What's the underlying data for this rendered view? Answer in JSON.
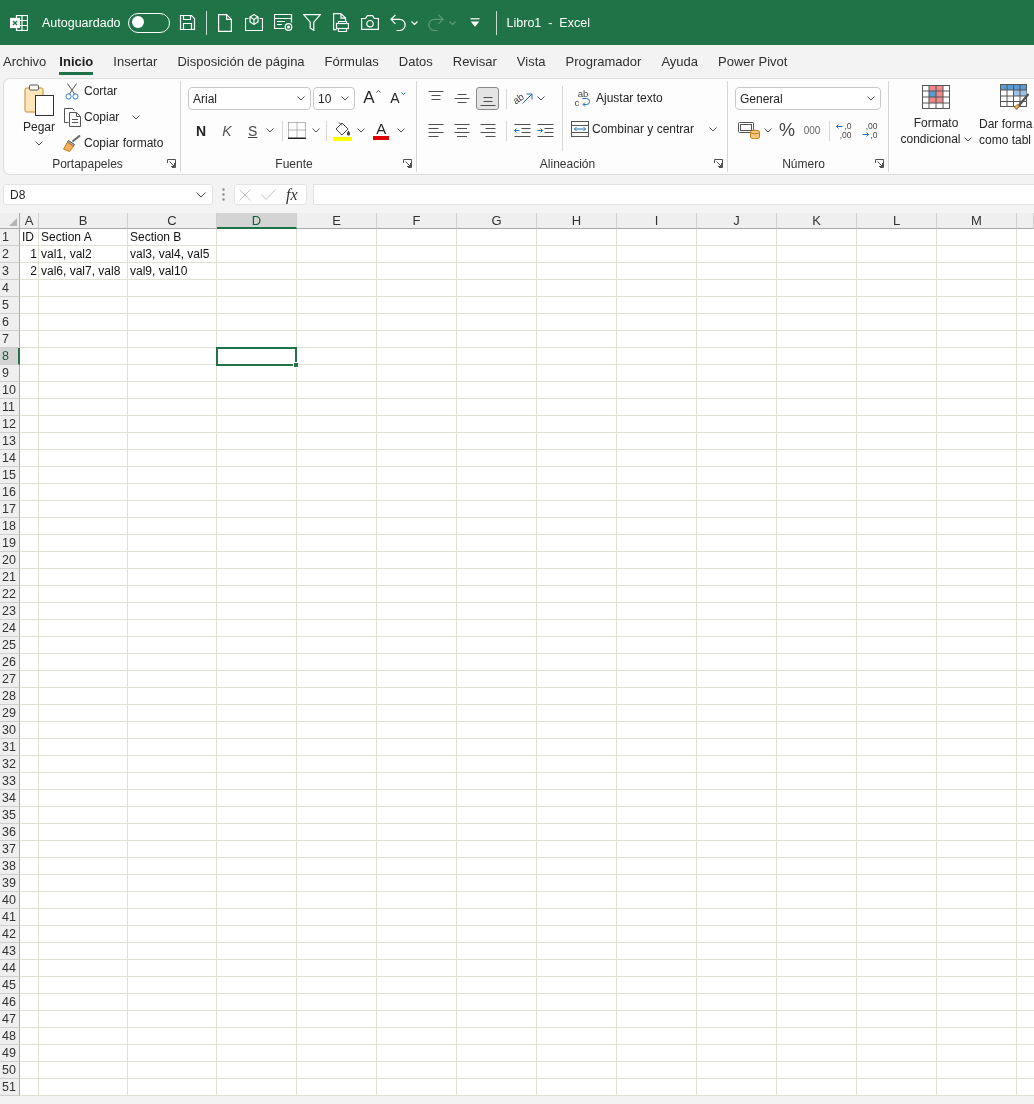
{
  "title_bar": {
    "autosave": {
      "label": "Autoguardado",
      "on": false
    },
    "quick_access": [
      {
        "kind": "save",
        "disabled": false
      },
      {
        "kind": "new",
        "disabled": false
      },
      {
        "kind": "cube",
        "disabled": false
      },
      {
        "kind": "form",
        "disabled": false
      },
      {
        "kind": "filter",
        "disabled": false
      },
      {
        "kind": "print",
        "disabled": false
      },
      {
        "kind": "camera",
        "disabled": false
      },
      {
        "kind": "undo",
        "disabled": false
      },
      {
        "kind": "redo",
        "disabled": true
      },
      {
        "kind": "customize",
        "disabled": false
      }
    ],
    "title": "Libro1  -  Excel"
  },
  "tabs": [
    {
      "label": "Archivo",
      "selected": false
    },
    {
      "label": "Inicio",
      "selected": true
    },
    {
      "label": "Insertar",
      "selected": false
    },
    {
      "label": "Disposición de página",
      "selected": false
    },
    {
      "label": "Fórmulas",
      "selected": false
    },
    {
      "label": "Datos",
      "selected": false
    },
    {
      "label": "Revisar",
      "selected": false
    },
    {
      "label": "Vista",
      "selected": false
    },
    {
      "label": "Programador",
      "selected": false
    },
    {
      "label": "Ayuda",
      "selected": false
    },
    {
      "label": "Power Pivot",
      "selected": false
    }
  ],
  "ribbon": {
    "clipboard": {
      "label": "Portapapeles",
      "paste": "Pegar",
      "cut": "Cortar",
      "copy": "Copiar",
      "format_painter": "Copiar formato"
    },
    "font": {
      "label": "Fuente",
      "font_name": "Arial",
      "font_size": "10",
      "grow_font": "A",
      "shrink_font": "A",
      "bold": "N",
      "italic": "K",
      "underline": "S",
      "font_color": "A"
    },
    "alignment": {
      "label": "Alineación",
      "vertical": [
        {
          "kind": "top",
          "selected": false
        },
        {
          "kind": "middle",
          "selected": false
        },
        {
          "kind": "bottom",
          "selected": true
        }
      ],
      "orientation": "ab",
      "horizontal": [
        {
          "kind": "left",
          "selected": false
        },
        {
          "kind": "center",
          "selected": false
        },
        {
          "kind": "right",
          "selected": false
        }
      ],
      "wrap_text": {
        "label": "Ajustar texto",
        "icon_letters": [
          "ab",
          "c"
        ]
      },
      "merge": "Combinar y centrar"
    },
    "number": {
      "label": "Número",
      "format": "General",
      "percent": "%",
      "thousands": "000",
      "increase_decimal": [
        ",0",
        ",00"
      ],
      "decrease_decimal": [
        ",00",
        ",0"
      ]
    },
    "styles": {
      "conditional_formatting": [
        "Formato",
        "condicional"
      ],
      "format_as_table": [
        "Dar forma",
        "como tabl"
      ]
    }
  },
  "formula_bar": {
    "name_box": "D8",
    "buttons": [
      {
        "kind": "cancel",
        "disabled": true
      },
      {
        "kind": "enter",
        "disabled": true
      }
    ],
    "function_label": "fx"
  },
  "sheet": {
    "columns": [
      {
        "label": "A",
        "selected": false
      },
      {
        "label": "B",
        "selected": false
      },
      {
        "label": "C",
        "selected": false
      },
      {
        "label": "D",
        "selected": true
      },
      {
        "label": "E",
        "selected": false
      },
      {
        "label": "F",
        "selected": false
      },
      {
        "label": "G",
        "selected": false
      },
      {
        "label": "H",
        "selected": false
      },
      {
        "label": "I",
        "selected": false
      },
      {
        "label": "J",
        "selected": false
      },
      {
        "label": "K",
        "selected": false
      },
      {
        "label": "L",
        "selected": false
      },
      {
        "label": "M",
        "selected": false
      }
    ],
    "rows": [
      {
        "label": "1",
        "selected": false,
        "cells": [
          {
            "kind": "text",
            "value": "ID"
          },
          {
            "kind": "text",
            "value": "Section A"
          },
          {
            "kind": "text",
            "value": "Section B"
          }
        ]
      },
      {
        "label": "2",
        "selected": false,
        "cells": [
          {
            "kind": "number",
            "value": "1"
          },
          {
            "kind": "text",
            "value": "val1, val2"
          },
          {
            "kind": "text",
            "value": "val3, val4, val5"
          }
        ]
      },
      {
        "label": "3",
        "selected": false,
        "cells": [
          {
            "kind": "number",
            "value": "2"
          },
          {
            "kind": "text",
            "value": "val6, val7, val8"
          },
          {
            "kind": "text",
            "value": "val9, val10"
          }
        ]
      },
      {
        "label": "4",
        "selected": false
      },
      {
        "label": "5",
        "selected": false
      },
      {
        "label": "6",
        "selected": false
      },
      {
        "label": "7",
        "selected": false
      },
      {
        "label": "8",
        "selected": true
      },
      {
        "label": "9",
        "selected": false
      },
      {
        "label": "10",
        "selected": false
      },
      {
        "label": "11",
        "selected": false
      },
      {
        "label": "12",
        "selected": false
      },
      {
        "label": "13",
        "selected": false
      },
      {
        "label": "14",
        "selected": false
      },
      {
        "label": "15",
        "selected": false
      },
      {
        "label": "16",
        "selected": false
      },
      {
        "label": "17",
        "selected": false
      },
      {
        "label": "18",
        "selected": false
      },
      {
        "label": "19",
        "selected": false
      },
      {
        "label": "20",
        "selected": false
      },
      {
        "label": "21",
        "selected": false
      },
      {
        "label": "22",
        "selected": false
      },
      {
        "label": "23",
        "selected": false
      },
      {
        "label": "24",
        "selected": false
      },
      {
        "label": "25",
        "selected": false
      },
      {
        "label": "26",
        "selected": false
      },
      {
        "label": "27",
        "selected": false
      },
      {
        "label": "28",
        "selected": false
      },
      {
        "label": "29",
        "selected": false
      },
      {
        "label": "30",
        "selected": false
      },
      {
        "label": "31",
        "selected": false
      },
      {
        "label": "32",
        "selected": false
      },
      {
        "label": "33",
        "selected": false
      },
      {
        "label": "34",
        "selected": false
      },
      {
        "label": "35",
        "selected": false
      },
      {
        "label": "36",
        "selected": false
      },
      {
        "label": "37",
        "selected": false
      },
      {
        "label": "38",
        "selected": false
      },
      {
        "label": "39",
        "selected": false
      },
      {
        "label": "40",
        "selected": false
      },
      {
        "label": "41",
        "selected": false
      },
      {
        "label": "42",
        "selected": false
      },
      {
        "label": "43",
        "selected": false
      },
      {
        "label": "44",
        "selected": false
      },
      {
        "label": "45",
        "selected": false
      },
      {
        "label": "46",
        "selected": false
      },
      {
        "label": "47",
        "selected": false
      },
      {
        "label": "48",
        "selected": false
      },
      {
        "label": "49",
        "selected": false
      },
      {
        "label": "50",
        "selected": false
      },
      {
        "label": "51",
        "selected": false
      }
    ]
  }
}
